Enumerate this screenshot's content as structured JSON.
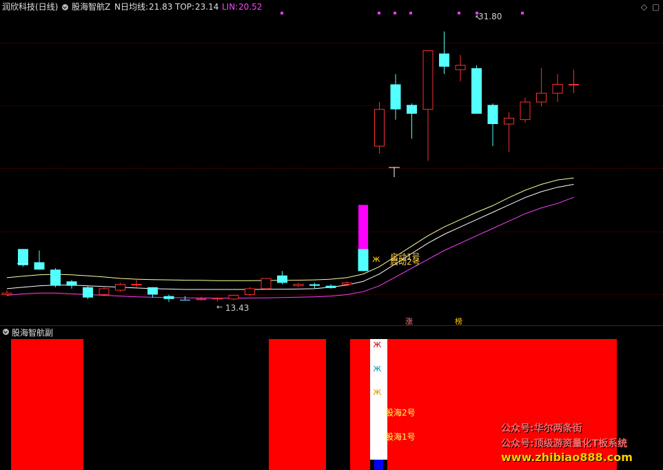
{
  "main_panel": {
    "stock_name": "润欣科技",
    "period": "(日线)",
    "indicator_name": "股海智航Z",
    "n_ma_label": "N日均线:",
    "n_ma_value": "21.83",
    "top_label": "TOP:",
    "top_value": "23.14",
    "lin_label": "LIN:",
    "lin_value": "20.52",
    "high_label": "31.80",
    "low_label": "13.43",
    "signal_1": "启动1号",
    "signal_2": "启动2号",
    "tag_rise": "涨",
    "tag_board": "榜"
  },
  "sub_panel": {
    "title": "股海智航副",
    "label_2": "股海2号",
    "label_1": "股海1号"
  },
  "watermark": {
    "line_1": "公众号:华尔两条街",
    "line_2": "公众号:顶级游资量化T板系统",
    "line_3": "www.zhibiao888.com"
  },
  "colors": {
    "up": "#ff3030",
    "down": "#54ffff",
    "ma_line": "#ffffa0",
    "top_line": "#ffffff",
    "lin_line": "#ff40ff",
    "magenta_bar": "#ff00ff",
    "sub_red": "#ff0000",
    "sub_white": "#ffffff",
    "sub_blue": "#0000ff"
  },
  "chart_data": {
    "type": "candlestick",
    "candles": [
      {
        "o": 13.9,
        "h": 14.2,
        "l": 13.8,
        "c": 14.0
      },
      {
        "o": 17.0,
        "h": 17.0,
        "l": 15.8,
        "c": 15.9
      },
      {
        "o": 16.1,
        "h": 16.9,
        "l": 15.6,
        "c": 15.6
      },
      {
        "o": 15.6,
        "h": 15.7,
        "l": 14.4,
        "c": 14.5
      },
      {
        "o": 14.8,
        "h": 14.9,
        "l": 14.3,
        "c": 14.5
      },
      {
        "o": 14.4,
        "h": 14.5,
        "l": 13.6,
        "c": 13.7
      },
      {
        "o": 13.9,
        "h": 14.4,
        "l": 13.8,
        "c": 14.3
      },
      {
        "o": 14.2,
        "h": 14.7,
        "l": 14.1,
        "c": 14.6
      },
      {
        "o": 14.55,
        "h": 14.9,
        "l": 14.4,
        "c": 14.6
      },
      {
        "o": 14.4,
        "h": 14.4,
        "l": 13.7,
        "c": 13.9
      },
      {
        "o": 13.8,
        "h": 13.9,
        "l": 13.4,
        "c": 13.6
      },
      {
        "o": 13.55,
        "h": 13.8,
        "l": 13.5,
        "c": 13.5
      },
      {
        "o": 13.6,
        "h": 13.75,
        "l": 13.5,
        "c": 13.6
      },
      {
        "o": 13.6,
        "h": 13.7,
        "l": 13.43,
        "c": 13.65
      },
      {
        "o": 13.6,
        "h": 13.8,
        "l": 13.5,
        "c": 13.85
      },
      {
        "o": 13.9,
        "h": 14.4,
        "l": 13.8,
        "c": 14.3
      },
      {
        "o": 14.3,
        "h": 15.0,
        "l": 14.2,
        "c": 15.0
      },
      {
        "o": 15.2,
        "h": 15.5,
        "l": 14.6,
        "c": 14.7
      },
      {
        "o": 14.5,
        "h": 14.7,
        "l": 14.4,
        "c": 14.6
      },
      {
        "o": 14.6,
        "h": 14.7,
        "l": 14.3,
        "c": 14.5
      },
      {
        "o": 14.5,
        "h": 14.6,
        "l": 14.3,
        "c": 14.35
      },
      {
        "o": 14.6,
        "h": 14.8,
        "l": 14.5,
        "c": 14.7
      },
      {
        "o": 17.0,
        "h": 17.0,
        "l": 15.5,
        "c": 15.5
      },
      {
        "o": 24.0,
        "h": 27.0,
        "l": 23.5,
        "c": 26.5
      },
      {
        "o": 28.2,
        "h": 28.9,
        "l": 25.8,
        "c": 26.5
      },
      {
        "o": 26.8,
        "h": 26.9,
        "l": 24.5,
        "c": 26.2
      },
      {
        "o": 26.5,
        "h": 30.5,
        "l": 23.0,
        "c": 30.5
      },
      {
        "o": 30.3,
        "h": 31.8,
        "l": 28.9,
        "c": 29.4
      },
      {
        "o": 29.2,
        "h": 30.2,
        "l": 28.4,
        "c": 29.5
      },
      {
        "o": 29.3,
        "h": 29.5,
        "l": 26.2,
        "c": 26.2
      },
      {
        "o": 26.8,
        "h": 26.9,
        "l": 24.0,
        "c": 25.5
      },
      {
        "o": 25.5,
        "h": 26.3,
        "l": 23.6,
        "c": 25.9
      },
      {
        "o": 25.8,
        "h": 27.3,
        "l": 25.6,
        "c": 27.0
      },
      {
        "o": 27.0,
        "h": 29.3,
        "l": 26.7,
        "c": 27.6
      },
      {
        "o": 27.6,
        "h": 28.9,
        "l": 27.0,
        "c": 28.2
      },
      {
        "o": 28.2,
        "h": 29.2,
        "l": 27.6,
        "c": 28.2
      }
    ],
    "ma_line": [
      15.05,
      15.15,
      15.25,
      15.28,
      15.25,
      15.18,
      15.1,
      15.0,
      14.95,
      14.92,
      14.9,
      14.88,
      14.87,
      14.85,
      14.85,
      14.85,
      14.86,
      14.87,
      14.88,
      14.9,
      14.95,
      15.05,
      15.3,
      15.8,
      16.5,
      17.2,
      17.9,
      18.5,
      19.0,
      19.5,
      19.95,
      20.5,
      21.0,
      21.4,
      21.7,
      21.83
    ],
    "top_line": [
      14.3,
      14.4,
      14.5,
      14.55,
      14.55,
      14.5,
      14.45,
      14.4,
      14.35,
      14.3,
      14.28,
      14.25,
      14.25,
      14.25,
      14.25,
      14.25,
      14.26,
      14.27,
      14.28,
      14.3,
      14.4,
      14.55,
      14.8,
      15.3,
      16.0,
      16.7,
      17.4,
      18.0,
      18.5,
      19.0,
      19.5,
      20.0,
      20.5,
      20.9,
      21.2,
      21.4
    ],
    "lin_line": [
      13.85,
      13.95,
      14.0,
      14.0,
      13.95,
      13.9,
      13.85,
      13.8,
      13.75,
      13.72,
      13.7,
      13.68,
      13.67,
      13.66,
      13.66,
      13.67,
      13.68,
      13.7,
      13.72,
      13.75,
      13.8,
      13.9,
      14.1,
      14.5,
      15.1,
      15.7,
      16.3,
      16.9,
      17.4,
      17.9,
      18.4,
      18.9,
      19.4,
      19.8,
      20.1,
      20.52
    ],
    "ylim": [
      12.0,
      33.0
    ]
  }
}
